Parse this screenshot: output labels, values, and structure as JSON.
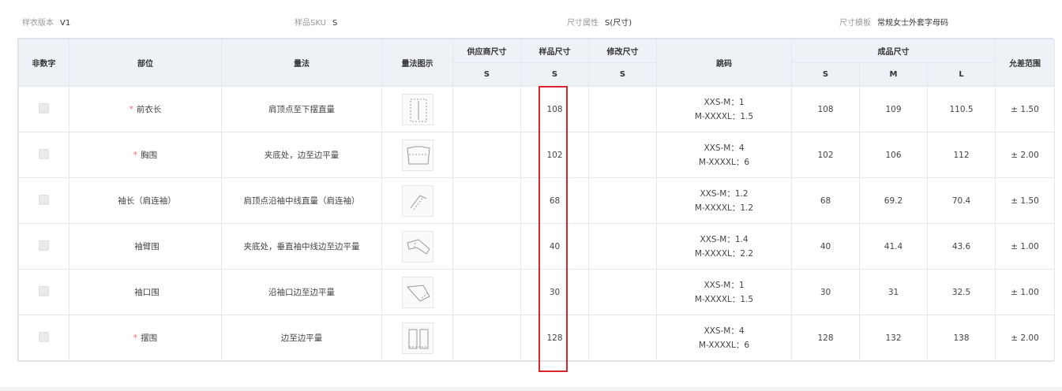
{
  "info": {
    "version_label": "样衣版本",
    "version_value": "V1",
    "sku_label": "样品SKU",
    "sku_value": "S",
    "attr_label": "尺寸属性",
    "attr_value": "S(尺寸)",
    "template_label": "尺寸模板",
    "template_value": "常规女士外套字母码"
  },
  "headers": {
    "non_numeric": "非数字",
    "part": "部位",
    "method": "量法",
    "method_image": "量法图示",
    "supplier_size": "供应商尺寸",
    "sample_size": "样品尺寸",
    "modified_size": "修改尺寸",
    "grading": "跳码",
    "finished_size": "成品尺寸",
    "tolerance": "允差范围",
    "supplier_sub": "S",
    "sample_sub": "S",
    "modified_sub": "S",
    "finished_s": "S",
    "finished_m": "M",
    "finished_l": "L"
  },
  "rows": [
    {
      "required": "*",
      "part": "前衣长",
      "method": "肩顶点至下摆直量",
      "supplier": "",
      "sample": "108",
      "modified": "",
      "grade1": "XXS-M：1",
      "grade2": "M-XXXXL：1.5",
      "s": "108",
      "m": "109",
      "l": "110.5",
      "tol": "± 1.50"
    },
    {
      "required": "*",
      "part": "胸围",
      "method": "夹底处，边至边平量",
      "supplier": "",
      "sample": "102",
      "modified": "",
      "grade1": "XXS-M：4",
      "grade2": "M-XXXXL：6",
      "s": "102",
      "m": "106",
      "l": "112",
      "tol": "± 2.00"
    },
    {
      "required": "",
      "part": "袖长（肩连袖）",
      "method": "肩顶点沿袖中线直量（肩连袖）",
      "supplier": "",
      "sample": "68",
      "modified": "",
      "grade1": "XXS-M：1.2",
      "grade2": "M-XXXXL：1.2",
      "s": "68",
      "m": "69.2",
      "l": "70.4",
      "tol": "± 1.50"
    },
    {
      "required": "",
      "part": "袖臂围",
      "method": "夹底处，垂直袖中线边至边平量",
      "supplier": "",
      "sample": "40",
      "modified": "",
      "grade1": "XXS-M：1.4",
      "grade2": "M-XXXXL：2.2",
      "s": "40",
      "m": "41.4",
      "l": "43.6",
      "tol": "± 1.00"
    },
    {
      "required": "",
      "part": "袖口围",
      "method": "沿袖口边至边平量",
      "supplier": "",
      "sample": "30",
      "modified": "",
      "grade1": "XXS-M：1",
      "grade2": "M-XXXXL：1.5",
      "s": "30",
      "m": "31",
      "l": "32.5",
      "tol": "± 1.00"
    },
    {
      "required": "*",
      "part": "摆围",
      "method": "边至边平量",
      "supplier": "",
      "sample": "128",
      "modified": "",
      "grade1": "XXS-M：4",
      "grade2": "M-XXXXL：6",
      "s": "128",
      "m": "132",
      "l": "138",
      "tol": "± 2.00"
    }
  ]
}
